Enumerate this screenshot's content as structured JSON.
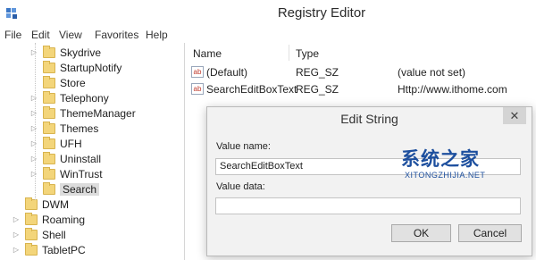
{
  "window": {
    "title": "Registry Editor",
    "app_icon": "registry-editor-icon"
  },
  "menu": [
    "File",
    "Edit",
    "View",
    "Favorites",
    "Help"
  ],
  "tree": [
    {
      "label": "Skydrive",
      "expander": "▷",
      "indent": 1
    },
    {
      "label": "StartupNotify",
      "expander": "",
      "indent": 1
    },
    {
      "label": "Store",
      "expander": "",
      "indent": 1
    },
    {
      "label": "Telephony",
      "expander": "▷",
      "indent": 1
    },
    {
      "label": "ThemeManager",
      "expander": "▷",
      "indent": 1
    },
    {
      "label": "Themes",
      "expander": "▷",
      "indent": 1
    },
    {
      "label": "UFH",
      "expander": "▷",
      "indent": 1
    },
    {
      "label": "Uninstall",
      "expander": "▷",
      "indent": 1
    },
    {
      "label": "WinTrust",
      "expander": "▷",
      "indent": 1
    },
    {
      "label": "Search",
      "expander": "",
      "indent": 1,
      "selected": true
    },
    {
      "label": "DWM",
      "expander": "",
      "indent": 0
    },
    {
      "label": "Roaming",
      "expander": "▷",
      "indent": 0
    },
    {
      "label": "Shell",
      "expander": "▷",
      "indent": 0
    },
    {
      "label": "TabletPC",
      "expander": "▷",
      "indent": 0
    }
  ],
  "list": {
    "headers": {
      "name": "Name",
      "type": "Type"
    },
    "rows": [
      {
        "icon": "string-value-icon",
        "icon_glyph": "ab",
        "name": "(Default)",
        "type": "REG_SZ",
        "data": "(value not set)"
      },
      {
        "icon": "string-value-icon",
        "icon_glyph": "ab",
        "name": "SearchEditBoxText",
        "type": "REG_SZ",
        "data": "Http://www.ithome.com"
      }
    ]
  },
  "dialog": {
    "title": "Edit String",
    "close_glyph": "✕",
    "value_name_label": "Value name:",
    "value_name": "SearchEditBoxText",
    "value_data_label": "Value data:",
    "value_data": "",
    "ok_label": "OK",
    "cancel_label": "Cancel"
  },
  "watermark": {
    "text": "系统之家",
    "sub": "XITONGZHIJIA.NET"
  },
  "colors": {
    "folder": "#f3d57a",
    "watermark": "#1d4f9e",
    "dialog_bg": "#f2f2f2"
  }
}
